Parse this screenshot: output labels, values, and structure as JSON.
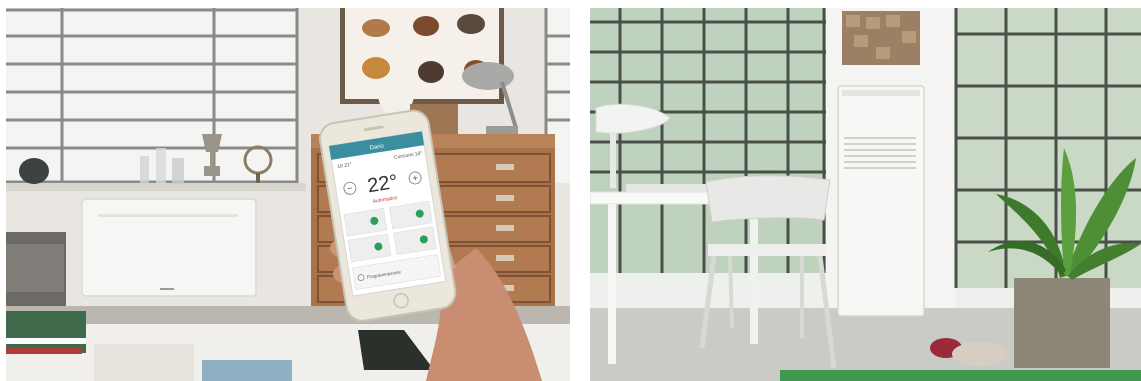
{
  "left_photo": {
    "alt": "Hand holding a smartphone showing an air conditioner control app in a room with a wall-mounted unit",
    "phone_app": {
      "header_title": "Dario",
      "status_left": "18 21°",
      "status_right": "Consumi 18°",
      "temperature": "22°",
      "minus_symbol": "−",
      "plus_symbol": "+",
      "mode_label": "Automatico",
      "bottom_text": "Programmazione"
    }
  },
  "right_photo": {
    "alt": "Bright room with a tall white indoor unit, a table with chairs, large windows and a banana plant"
  }
}
